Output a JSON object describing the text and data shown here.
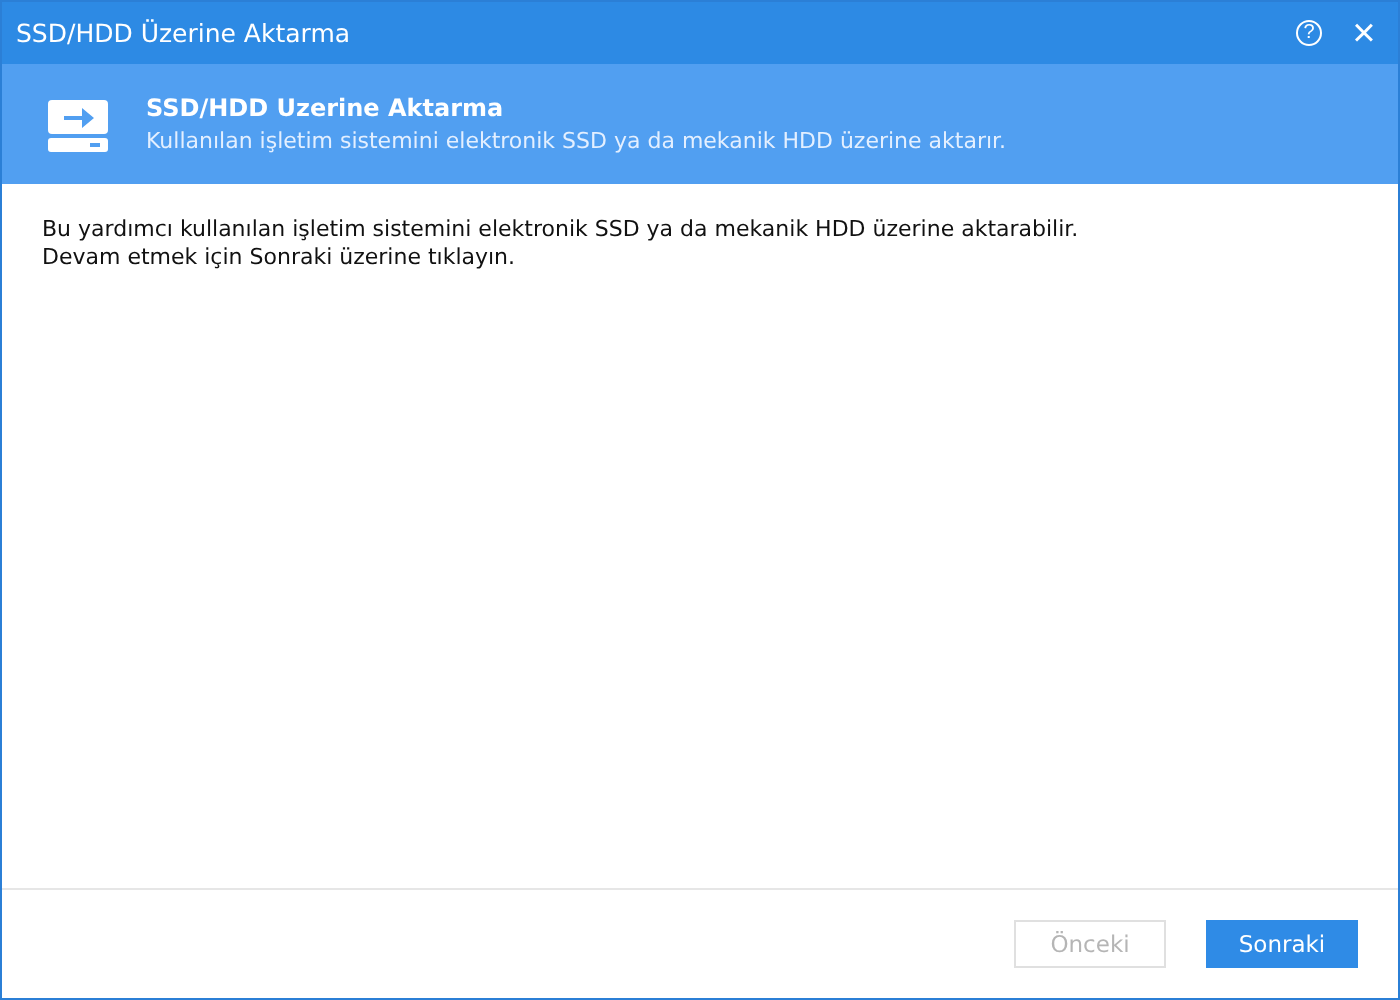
{
  "window": {
    "title": "SSD/HDD Üzerine Aktarma",
    "help": "?",
    "close": "×"
  },
  "header": {
    "title": "SSD/HDD Uzerine Aktarma",
    "subtitle": "Kullanılan işletim sistemini elektronik SSD ya da mekanik HDD üzerine aktarır."
  },
  "body": [
    "Bu yardımcı kullanılan işletim sistemini elektronik SSD ya da mekanik HDD üzerine aktarabilir.",
    "Devam etmek için Sonraki üzerine tıklayın."
  ],
  "buttons": [
    {
      "label": "Önceki",
      "disabled": true,
      "kind": "secondary"
    },
    {
      "label": "Sonraki",
      "disabled": false,
      "kind": "primary"
    }
  ]
}
